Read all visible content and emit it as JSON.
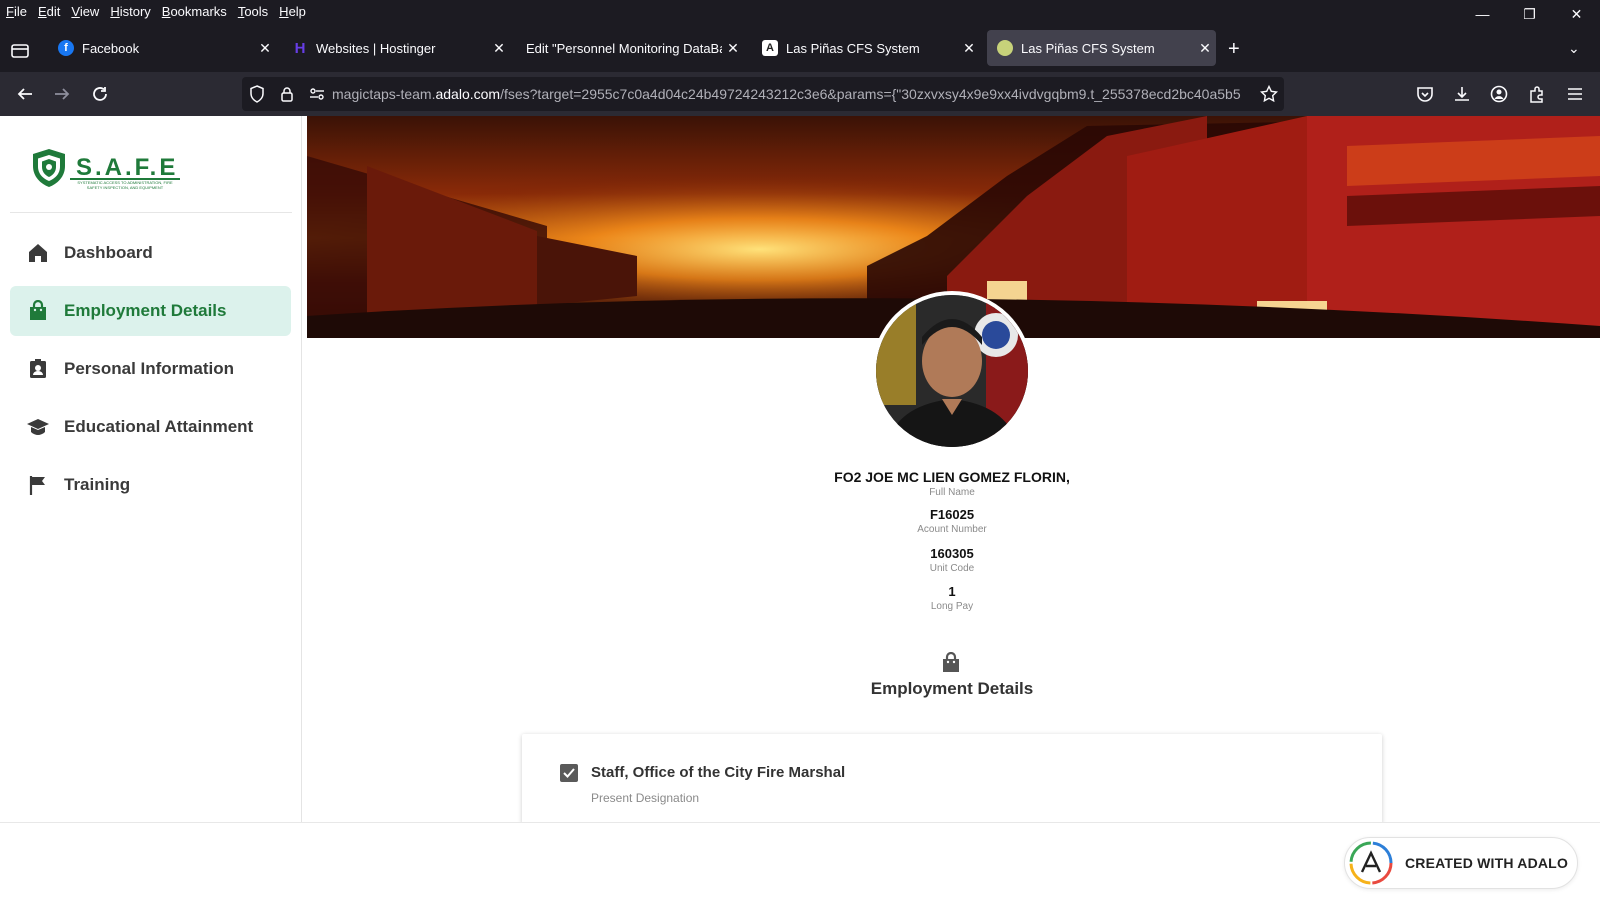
{
  "menu": [
    "File",
    "Edit",
    "View",
    "History",
    "Bookmarks",
    "Tools",
    "Help"
  ],
  "tabs": [
    {
      "title": "Facebook",
      "favicon": "facebook-icon",
      "color": "#1877f2"
    },
    {
      "title": "Websites | Hostinger",
      "favicon": "hostinger-icon",
      "color": "#673de6"
    },
    {
      "title": "Edit \"Personnel Monitoring DataBas",
      "favicon": "",
      "color": ""
    },
    {
      "title": "Las Piñas CFS System",
      "favicon": "adalo-icon",
      "color": "#ffffff"
    },
    {
      "title": "Las Piñas CFS System",
      "favicon": "safe-seal-icon",
      "color": "#c7d27a"
    }
  ],
  "url": {
    "prefix": "magictaps-team.",
    "domain": "adalo.com",
    "rest": "/fses?target=2955c7c0a4d04c24b49724243212c3e6&params={\"30zxvxsy4x9e9xx4ivdvgqbm9.t_255378ecd2bc40a5b5"
  },
  "logo": {
    "text": "S.A.F.E",
    "subtitle": "SYSTEMATIC ACCESS TO ADMINISTRATION, FIRE SAFETY INSPECTION, AND EQUIPMENT"
  },
  "sidebar": {
    "items": [
      {
        "label": "Dashboard",
        "icon": "home-icon",
        "active": false
      },
      {
        "label": "Employment Details",
        "icon": "briefcase-icon",
        "active": true
      },
      {
        "label": "Personal Information",
        "icon": "id-badge-icon",
        "active": false
      },
      {
        "label": "Educational Attainment",
        "icon": "graduation-cap-icon",
        "active": false
      },
      {
        "label": "Training",
        "icon": "flag-icon",
        "active": false
      }
    ]
  },
  "profile": {
    "name": "FO2 JOE MC LIEN GOMEZ FLORIN,",
    "name_label": "Full Name",
    "account": "F16025",
    "account_label": "Acount Number",
    "unit": "160305",
    "unit_label": "Unit Code",
    "longpay": "1",
    "longpay_label": "Long Pay"
  },
  "section": {
    "title": "Employment Details",
    "icon": "briefcase-icon"
  },
  "designation": {
    "value": "Staff, Office of the City Fire Marshal",
    "label": "Present Designation",
    "checked": true
  },
  "footer": {
    "badge": "CREATED WITH ADALO"
  },
  "colors": {
    "accent": "#1f7a3a",
    "active_bg": "#dcf2ec",
    "browser_dark": "#1c1b22"
  }
}
